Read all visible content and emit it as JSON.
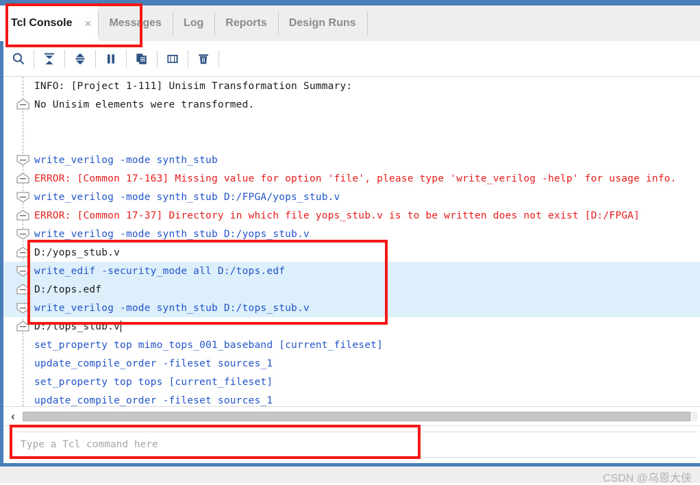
{
  "window": {
    "accent_color": "#4a7ebb",
    "tab_bar_bg": "#eeeeee"
  },
  "tabs": [
    {
      "label": "Tcl Console",
      "active": true,
      "closable": true,
      "close_glyph": "×"
    },
    {
      "label": "Messages",
      "active": false,
      "closable": false
    },
    {
      "label": "Log",
      "active": false,
      "closable": false
    },
    {
      "label": "Reports",
      "active": false,
      "closable": false
    },
    {
      "label": "Design Runs",
      "active": false,
      "closable": false
    }
  ],
  "toolbar": {
    "buttons": [
      {
        "name": "search-icon",
        "tooltip": "Search"
      },
      {
        "name": "collapse-all-icon",
        "tooltip": "Collapse All"
      },
      {
        "name": "expand-all-icon",
        "tooltip": "Expand All"
      },
      {
        "name": "pause-icon",
        "tooltip": "Pause"
      },
      {
        "name": "copy-icon",
        "tooltip": "Copy"
      },
      {
        "name": "show-output-panel-icon",
        "tooltip": "Show Output"
      },
      {
        "name": "clear-console-icon",
        "tooltip": "Clear Console"
      }
    ]
  },
  "console": {
    "colors": {
      "command": "#2255cc",
      "error": "#e81b1b",
      "output": "#1b1b1b",
      "selection_bg": "#ddeffa"
    },
    "lines": [
      {
        "marker": "none",
        "kind": "info",
        "text": "INFO: [Project 1-111] Unisim Transformation Summary:",
        "selected": false
      },
      {
        "marker": "result",
        "kind": "output",
        "text": "No Unisim elements were transformed.",
        "selected": false
      },
      {
        "marker": "none",
        "kind": "output",
        "text": "",
        "selected": false
      },
      {
        "marker": "none",
        "kind": "output",
        "text": "",
        "selected": false
      },
      {
        "marker": "command",
        "kind": "command",
        "text": "write_verilog -mode synth_stub",
        "selected": false
      },
      {
        "marker": "result",
        "kind": "error",
        "text": "ERROR: [Common 17-163] Missing value for option 'file', please type 'write_verilog -help' for usage info.",
        "selected": false
      },
      {
        "marker": "command",
        "kind": "command",
        "text": "write_verilog -mode synth_stub D:/FPGA/yops_stub.v",
        "selected": false
      },
      {
        "marker": "result",
        "kind": "error",
        "text": "ERROR: [Common 17-37] Directory in which file yops_stub.v is to be written does not exist [D:/FPGA]",
        "selected": false
      },
      {
        "marker": "command",
        "kind": "command",
        "text": "write_verilog -mode synth_stub D:/yops_stub.v",
        "selected": false
      },
      {
        "marker": "result",
        "kind": "output",
        "text": "D:/yops_stub.v",
        "selected": false
      },
      {
        "marker": "command",
        "kind": "command",
        "text": "write_edif -security_mode all D:/tops.edf",
        "selected": true
      },
      {
        "marker": "result",
        "kind": "output",
        "text": "D:/tops.edf",
        "selected": true
      },
      {
        "marker": "command",
        "kind": "command",
        "text": "write_verilog -mode synth_stub D:/tops_stub.v",
        "selected": true
      },
      {
        "marker": "result",
        "kind": "output",
        "text": "D:/tops_stub.v",
        "selected": false,
        "caret": true
      },
      {
        "marker": "none",
        "kind": "command",
        "text": "set_property top mimo_tops_001_baseband [current_fileset]",
        "selected": false
      },
      {
        "marker": "none",
        "kind": "command",
        "text": "update_compile_order -fileset sources_1",
        "selected": false
      },
      {
        "marker": "none",
        "kind": "command",
        "text": "set_property top tops [current_fileset]",
        "selected": false
      },
      {
        "marker": "none",
        "kind": "command",
        "text": "update_compile_order -fileset sources_1",
        "selected": false
      }
    ]
  },
  "scrollbar": {
    "left_arrow_glyph": "‹",
    "orientation": "horizontal"
  },
  "command_input": {
    "value": "",
    "placeholder": "Type a Tcl command here"
  },
  "footer": {
    "watermark": "CSDN @乌恩大侠"
  },
  "annotations": {
    "highlight_color": "#f51616",
    "boxes": [
      {
        "name": "tcl-console-tab-highlight"
      },
      {
        "name": "selected-commands-highlight"
      },
      {
        "name": "command-input-highlight"
      }
    ]
  }
}
